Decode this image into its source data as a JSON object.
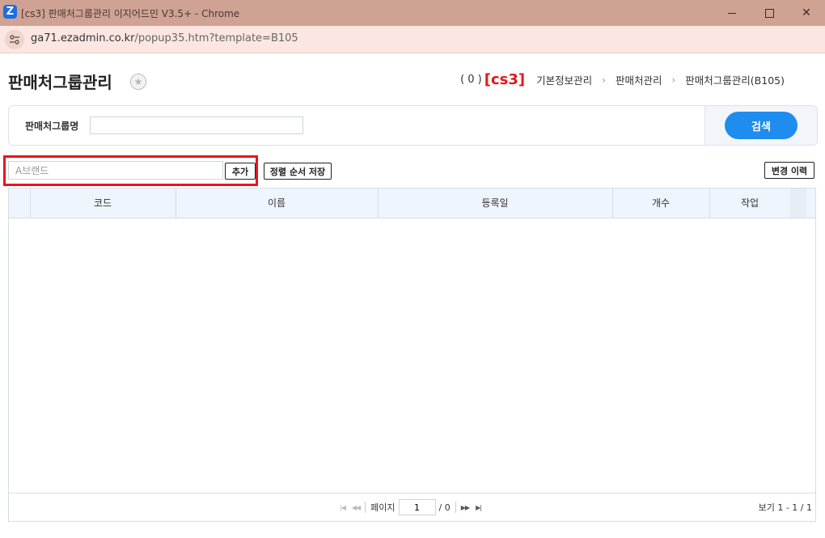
{
  "window": {
    "title": "[cs3] 판매처그룹관리 이지어드민 V3.5+ - Chrome",
    "app_icon": "Z"
  },
  "address": {
    "host": "ga71.ezadmin.co.kr",
    "path": "/popup35.htm?template=B105"
  },
  "header": {
    "title": "판매처그룹관리",
    "breadcrumb": {
      "count": "( 0 )",
      "brand": "[cs3]",
      "items": [
        "기본정보관리",
        "판매처관리",
        "판매처그룹관리(B105)"
      ],
      "separator": "›"
    }
  },
  "search": {
    "label": "판매처그룹명",
    "value": "",
    "button_label": "검색"
  },
  "toolbar": {
    "brand_placeholder": "A브랜드",
    "add_label": "추가",
    "sort_save_label": "정렬 순서 저장",
    "history_label": "변경 이력"
  },
  "grid": {
    "columns": [
      "코드",
      "이름",
      "등록일",
      "개수",
      "작업"
    ],
    "rows": []
  },
  "pagination": {
    "page_label": "페이지",
    "current_page": "1",
    "total": "/ 0",
    "view_info": "보기 1 - 1 / 1"
  },
  "colors": {
    "titlebar": "#cfa293",
    "addressbar": "#fbe6e2",
    "accent": "#1f8cf0",
    "brand_red": "#e0191a",
    "highlight": "#e8141d"
  }
}
